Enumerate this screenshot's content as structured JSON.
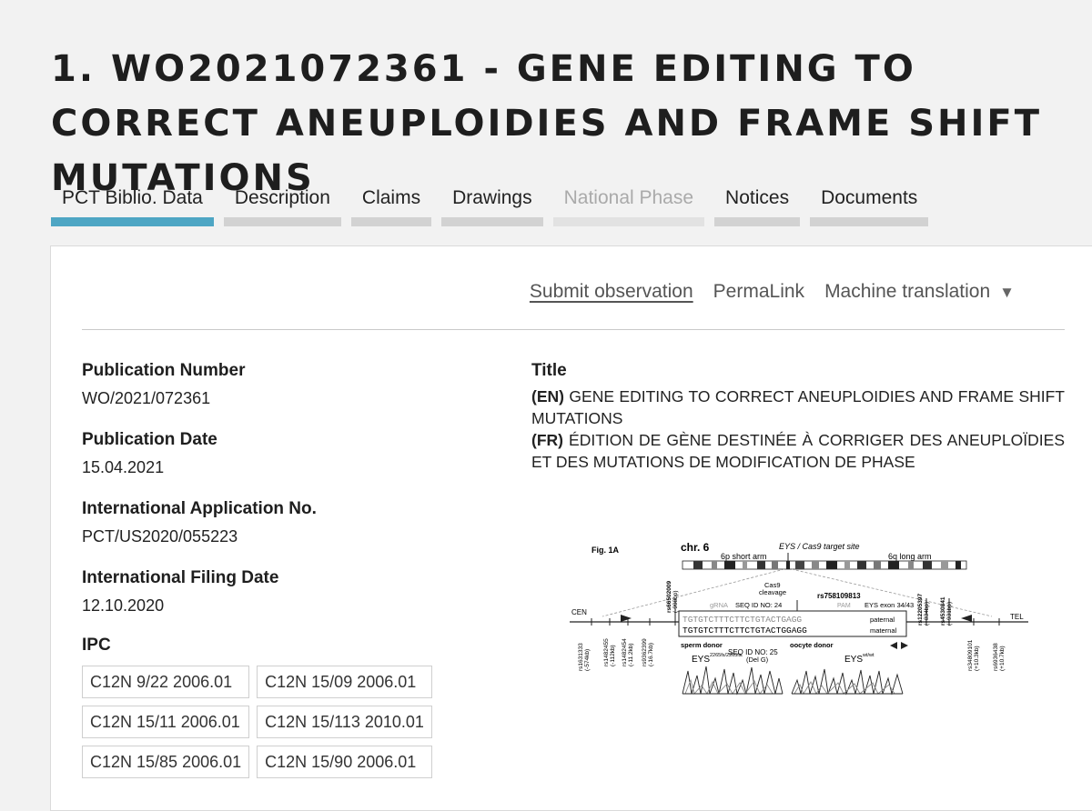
{
  "page": {
    "title": "1. WO2021072361 - GENE EDITING TO CORRECT ANEUPLOIDIES AND FRAME SHIFT MUTATIONS"
  },
  "tabs": [
    {
      "label": "PCT Biblio. Data"
    },
    {
      "label": "Description"
    },
    {
      "label": "Claims"
    },
    {
      "label": "Drawings"
    },
    {
      "label": "National Phase"
    },
    {
      "label": "Notices"
    },
    {
      "label": "Documents"
    }
  ],
  "actions": {
    "submit": "Submit observation",
    "permalink": "PermaLink",
    "translation": "Machine translation",
    "caret": "▼"
  },
  "biblio": {
    "pub_number_label": "Publication Number",
    "pub_number": "WO/2021/072361",
    "pub_date_label": "Publication Date",
    "pub_date": "15.04.2021",
    "app_no_label": "International Application No.",
    "app_no": "PCT/US2020/055223",
    "filing_date_label": "International Filing Date",
    "filing_date": "12.10.2020",
    "ipc_label": "IPC",
    "ipc": [
      "C12N 9/22 2006.01",
      "C12N 15/09 2006.01",
      "C12N 15/11 2006.01",
      "C12N 15/113 2010.01",
      "C12N 15/85 2006.01",
      "C12N 15/90 2006.01"
    ]
  },
  "title_section": {
    "label": "Title",
    "en_tag": "(EN)",
    "en_text": "GENE EDITING TO CORRECT ANEUPLOIDIES AND FRAME SHIFT MUTATIONS",
    "fr_tag": "(FR)",
    "fr_text": "ÉDITION DE GÈNE DESTINÉE À CORRIGER DES ANEUPLOÏDIES ET DES MUTATIONS DE MODIFICATION DE PHASE"
  },
  "figure": {
    "fig": "Fig. 1A",
    "chr": "chr. 6",
    "target": "EYS / Cas9 target site",
    "p_arm": "6p short arm",
    "q_arm": "6q long arm",
    "cleavage1": "Cas9",
    "cleavage2": "cleavage",
    "grna": "gRNA",
    "pam": "PAM",
    "exon": "EYS exon 34/43",
    "rs_main": "rs758109813",
    "seq24": "SEQ ID NO: 24",
    "seq25": "SEQ ID NO: 25",
    "paternal_seq": "TGTGTCTTTCTTCTGTACTGAGG",
    "maternal_seq": "TGTGTCTTTCTTCTGTACTGGAGG",
    "paternal": "paternal",
    "maternal": "maternal",
    "cen": "CEN",
    "tel": "TEL",
    "sperm": "sperm donor",
    "oocyte": "oocyte donor",
    "eys": "EYS",
    "eys_sup1": "2265fs/2265fs",
    "delg": "(Del G)",
    "eys_sup2": "wt/wt",
    "rs_labels": [
      "rs1631333",
      "rs1482455",
      "rs1482454",
      "rs9362399",
      "rs66502009",
      "rs12205397",
      "rs4530841",
      "rs34809101",
      "rs6936438"
    ],
    "rs_dist": [
      "(-574kb)",
      "(-112kb)",
      "(-11.2kb)",
      "(-16.7kb)",
      "(-998bp)",
      "(+834bp)",
      "(+931bp)",
      "(+10.3kb)",
      "(+10.7kb)"
    ]
  }
}
